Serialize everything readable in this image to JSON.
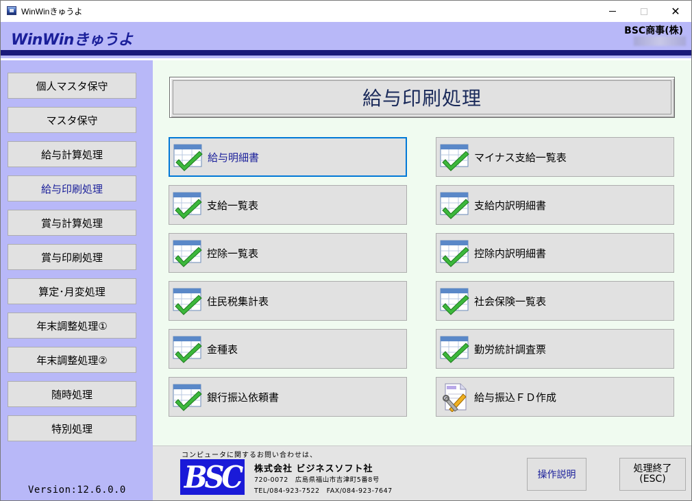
{
  "window": {
    "title": "WinWinきゅうよ"
  },
  "header": {
    "app_title": "WinWinきゅうよ",
    "company": "BSC商事(株)"
  },
  "sidebar": {
    "items": [
      {
        "label": "個人マスタ保守"
      },
      {
        "label": "マスタ保守"
      },
      {
        "label": "給与計算処理"
      },
      {
        "label": "給与印刷処理",
        "active": true
      },
      {
        "label": "賞与計算処理"
      },
      {
        "label": "賞与印刷処理"
      },
      {
        "label": "算定･月変処理"
      },
      {
        "label": "年末調整処理①"
      },
      {
        "label": "年末調整処理②"
      },
      {
        "label": "随時処理"
      },
      {
        "label": "特別処理"
      }
    ],
    "version": "Version:12.6.0.0"
  },
  "main": {
    "page_title": "給与印刷処理",
    "menu_left": [
      {
        "label": "給与明細書",
        "icon": "checklist-icon",
        "focused": true
      },
      {
        "label": "支給一覧表",
        "icon": "checklist-icon"
      },
      {
        "label": "控除一覧表",
        "icon": "checklist-icon"
      },
      {
        "label": "住民税集計表",
        "icon": "checklist-icon"
      },
      {
        "label": "金種表",
        "icon": "checklist-icon"
      },
      {
        "label": "銀行振込依頼書",
        "icon": "checklist-icon"
      }
    ],
    "menu_right": [
      {
        "label": "マイナス支給一覧表",
        "icon": "checklist-icon"
      },
      {
        "label": "支給内訳明細書",
        "icon": "checklist-icon"
      },
      {
        "label": "控除内訳明細書",
        "icon": "checklist-icon"
      },
      {
        "label": "社会保険一覧表",
        "icon": "checklist-icon"
      },
      {
        "label": "勤労統計調査票",
        "icon": "checklist-icon"
      },
      {
        "label": "給与振込ＦＤ作成",
        "icon": "document-tools-icon"
      }
    ]
  },
  "footer": {
    "contact_note": "コンピュータに関するお問い合わせは、",
    "logo_text": "BSC",
    "company_name": "株式会社 ビジネスソフト社",
    "address": "720-0072　広島県福山市吉津町5番8号",
    "phone": "TEL/084-923-7522　FAX/084-923-7647",
    "help_label": "操作説明",
    "exit_label_line1": "処理終了",
    "exit_label_line2": "(ESC)"
  },
  "colors": {
    "header_band": "#b8b8f8",
    "header_stripe": "#1a1a7a",
    "main_bg": "#f0fbf0",
    "accent_text": "#1a1f9a",
    "logo_blue": "#1a1ad8",
    "focus_border": "#0078d7"
  }
}
